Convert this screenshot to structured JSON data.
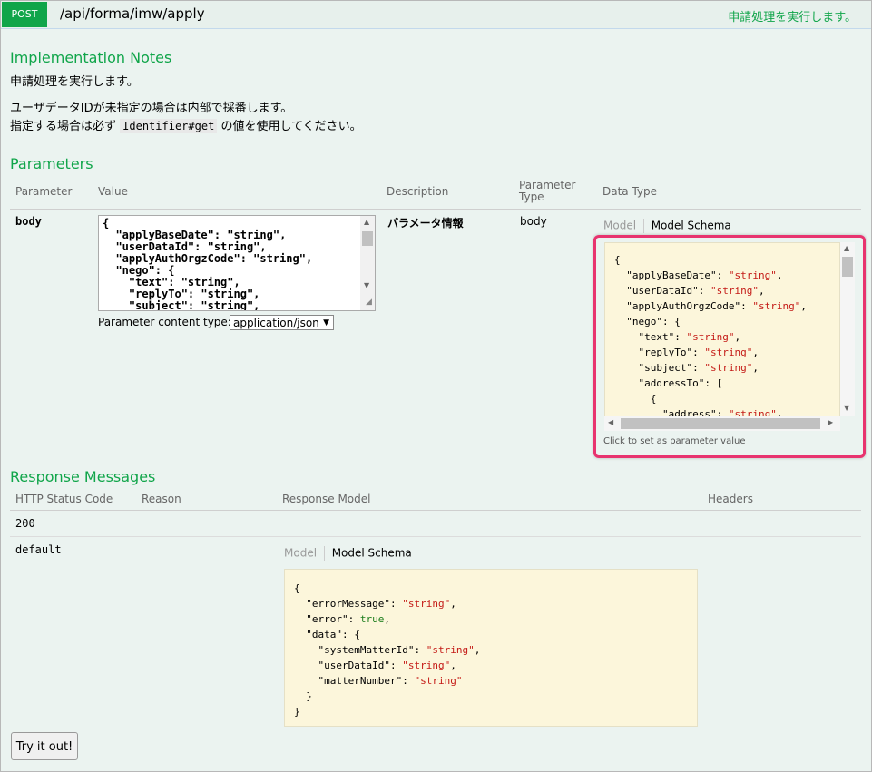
{
  "operation": {
    "method": "POST",
    "path": "/api/forma/imw/apply",
    "summary": "申請処理を実行します。"
  },
  "implementation_notes": {
    "heading": "Implementation Notes",
    "line1": "申請処理を実行します。",
    "line2": "ユーザデータIDが未指定の場合は内部で採番します。",
    "line3_before": "指定する場合は必ず",
    "line3_code": "Identifier#get",
    "line3_after": "の値を使用してください。"
  },
  "parameters": {
    "heading": "Parameters",
    "columns": {
      "parameter": "Parameter",
      "value": "Value",
      "description": "Description",
      "parameter_type": "Parameter Type",
      "data_type": "Data Type"
    },
    "row": {
      "name": "body",
      "value": "{\n  \"applyBaseDate\": \"string\",\n  \"userDataId\": \"string\",\n  \"applyAuthOrgzCode\": \"string\",\n  \"nego\": {\n    \"text\": \"string\",\n    \"replyTo\": \"string\",\n    \"subject\": \"string\",",
      "description": "パラメータ情報",
      "parameter_type": "body",
      "content_type_label": "Parameter content type:",
      "content_type_value": "application/json",
      "tab_model": "Model",
      "tab_schema": "Model Schema",
      "hint": "Click to set as parameter value"
    }
  },
  "responses": {
    "heading": "Response Messages",
    "columns": {
      "status": "HTTP Status Code",
      "reason": "Reason",
      "model": "Response Model",
      "headers": "Headers"
    },
    "rows": [
      {
        "status": "200"
      },
      {
        "status": "default",
        "tab_model": "Model",
        "tab_schema": "Model Schema"
      }
    ]
  },
  "try_button": "Try it out!",
  "colors": {
    "accent": "#10a54a",
    "highlight": "#e8336f",
    "snippet_bg": "#fcf6db",
    "panel_bg": "#ebf3f0"
  }
}
